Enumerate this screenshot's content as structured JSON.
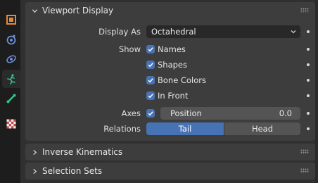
{
  "colors": {
    "background": "#303030",
    "panel": "#3d3d3d",
    "accent": "#4772b3",
    "field": "#545454",
    "dropdown": "#282828",
    "tabbar": "#1d1d1d"
  },
  "tabs": [
    {
      "name": "tool-icon",
      "active": false
    },
    {
      "name": "render-icon",
      "active": false
    },
    {
      "name": "physics-icon",
      "active": false
    },
    {
      "name": "armature-data-icon",
      "active": true
    },
    {
      "name": "bone-icon",
      "active": false
    },
    {
      "name": "texture-icon",
      "active": false
    }
  ],
  "viewport_display": {
    "title": "Viewport Display",
    "display_as": {
      "label": "Display As",
      "value": "Octahedral"
    },
    "show": {
      "label": "Show",
      "names": {
        "label": "Names",
        "checked": true
      },
      "shapes": {
        "label": "Shapes",
        "checked": true
      },
      "bone_colors": {
        "label": "Bone Colors",
        "checked": true
      },
      "in_front": {
        "label": "In Front",
        "checked": true
      }
    },
    "axes": {
      "label": "Axes",
      "checked": true,
      "position_label": "Position",
      "position_value": "0.0"
    },
    "relations": {
      "label": "Relations",
      "options": [
        "Tail",
        "Head"
      ],
      "selected": "Tail"
    }
  },
  "inverse_kinematics": {
    "title": "Inverse Kinematics",
    "expanded": false
  },
  "selection_sets": {
    "title": "Selection Sets",
    "expanded": false
  }
}
